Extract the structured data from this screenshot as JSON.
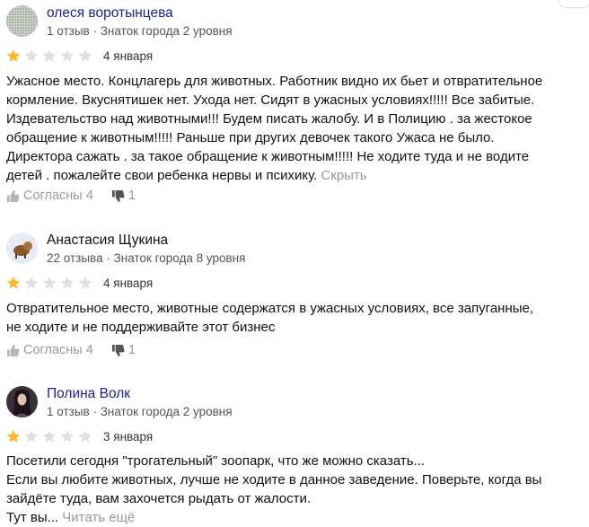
{
  "colors": {
    "star_filled": "#fdb92a",
    "star_empty": "#e0e0e0",
    "name": "#1c1d8f",
    "muted": "#999999"
  },
  "reviews": [
    {
      "author": "олеся воротынцева",
      "meta": "1 отзыв · Знаток города 2 уровня",
      "rating": 1,
      "date": "4 января",
      "text_lines": [
        "Ужасное место. Концлагерь для животных. Работник видно их бьет и отвратительное",
        "кормление. Вкуснятишек нет. Ухода нет. Сидят в ужасных условиях!!!!! Все забитые.",
        "Издевательство над животными!!! Будем писать жалобу. И в Полицию . за жестокое",
        "обращение к животным!!!!! Раньше при других девочек такого Ужаса не было.",
        "Директора сажать . за такое обращение к животным!!!!! Не ходите туда и не водите",
        "детей . пожалейте свои ребенка нервы и психику."
      ],
      "toggle_label": "Скрыть",
      "agree_label": "Согласны 4",
      "disagree_count": "1"
    },
    {
      "author": "Анастасия Щукина",
      "meta": "22 отзыва · Знаток города 8 уровня",
      "rating": 1,
      "date": "4 января",
      "text_lines": [
        "Отвратительное место, животные содержатся в ужасных условиях, все запуганные,",
        "не ходите и не поддерживайте этот бизнес"
      ],
      "agree_label": "Согласны 4",
      "disagree_count": "1"
    },
    {
      "author": "Полина Волк",
      "meta": "1 отзыв · Знаток города 2 уровня",
      "rating": 1,
      "date": "3 января",
      "text_lines": [
        "Посетили сегодня \"трогательный\" зоопарк, что же можно сказать...",
        "Если вы любите животных, лучше не ходите в данное заведение. Поверьте, когда вы",
        "зайдёте туда, вам захочется рыдать от жалости.",
        "Тут вы..."
      ],
      "toggle_label": "Читать ещё"
    }
  ]
}
